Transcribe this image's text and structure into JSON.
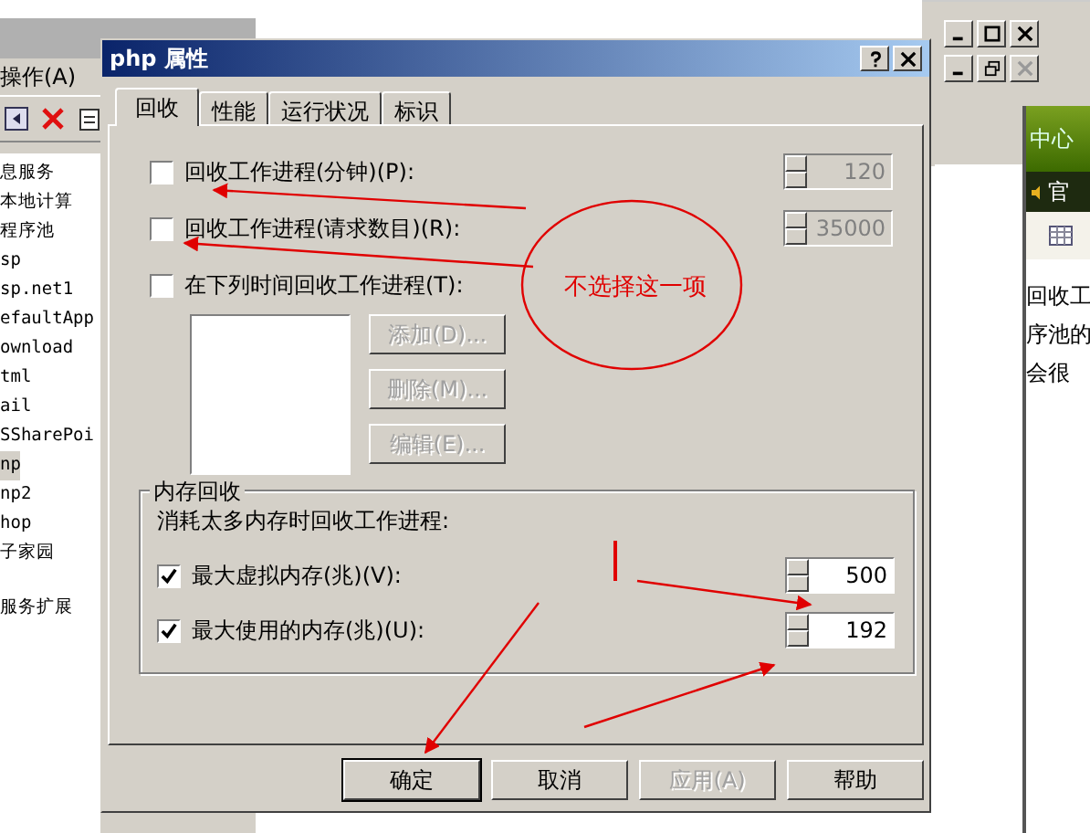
{
  "background_window": {
    "menu": "操作(A)",
    "tree_items": [
      {
        "label": "息服务",
        "selected": false
      },
      {
        "label": "本地计算",
        "selected": false
      },
      {
        "label": "程序池",
        "selected": false
      },
      {
        "label": "sp",
        "selected": false
      },
      {
        "label": "sp.net1",
        "selected": false
      },
      {
        "label": "efaultApp",
        "selected": false
      },
      {
        "label": "ownload",
        "selected": false
      },
      {
        "label": "tml",
        "selected": false
      },
      {
        "label": "ail",
        "selected": false
      },
      {
        "label": "SSharePoi",
        "selected": false
      },
      {
        "label": "np",
        "selected": true
      },
      {
        "label": "np2",
        "selected": false
      },
      {
        "label": "hop",
        "selected": false
      },
      {
        "label": "子家园",
        "selected": false
      },
      {
        "label": "服务扩展",
        "selected": false
      }
    ]
  },
  "right_window": {
    "banner": "中心",
    "link": "官",
    "text_lines": [
      "回收工",
      "序池的",
      "会很"
    ]
  },
  "dialog": {
    "title": "php 属性",
    "tabs": [
      {
        "label": "回收",
        "selected": true
      },
      {
        "label": "性能",
        "selected": false
      },
      {
        "label": "运行状况",
        "selected": false
      },
      {
        "label": "标识",
        "selected": false
      }
    ],
    "recycle_options": [
      {
        "kind": "spinner",
        "label": "回收工作进程(分钟)(P):",
        "checked": false,
        "value": "120",
        "disabled": true
      },
      {
        "kind": "spinner",
        "label": "回收工作进程(请求数目)(R):",
        "checked": false,
        "value": "35000",
        "disabled": true
      },
      {
        "kind": "schedule",
        "label": "在下列时间回收工作进程(T):",
        "checked": false
      }
    ],
    "schedule_buttons": [
      {
        "label": "添加(D)...",
        "disabled": true
      },
      {
        "label": "删除(M)...",
        "disabled": true
      },
      {
        "label": "编辑(E)...",
        "disabled": true
      }
    ],
    "memory_group": {
      "title": "内存回收",
      "description": "消耗太多内存时回收工作进程:",
      "options": [
        {
          "label": "最大虚拟内存(兆)(V):",
          "checked": true,
          "value": "500",
          "disabled": false
        },
        {
          "label": "最大使用的内存(兆)(U):",
          "checked": true,
          "value": "192",
          "disabled": false
        }
      ]
    },
    "buttons": [
      {
        "label": "确定",
        "default": true,
        "disabled": false
      },
      {
        "label": "取消",
        "default": false,
        "disabled": false
      },
      {
        "label": "应用(A)",
        "default": false,
        "disabled": true
      },
      {
        "label": "帮助",
        "default": false,
        "disabled": false
      }
    ]
  },
  "annotation": {
    "note": "不选择这一项"
  }
}
